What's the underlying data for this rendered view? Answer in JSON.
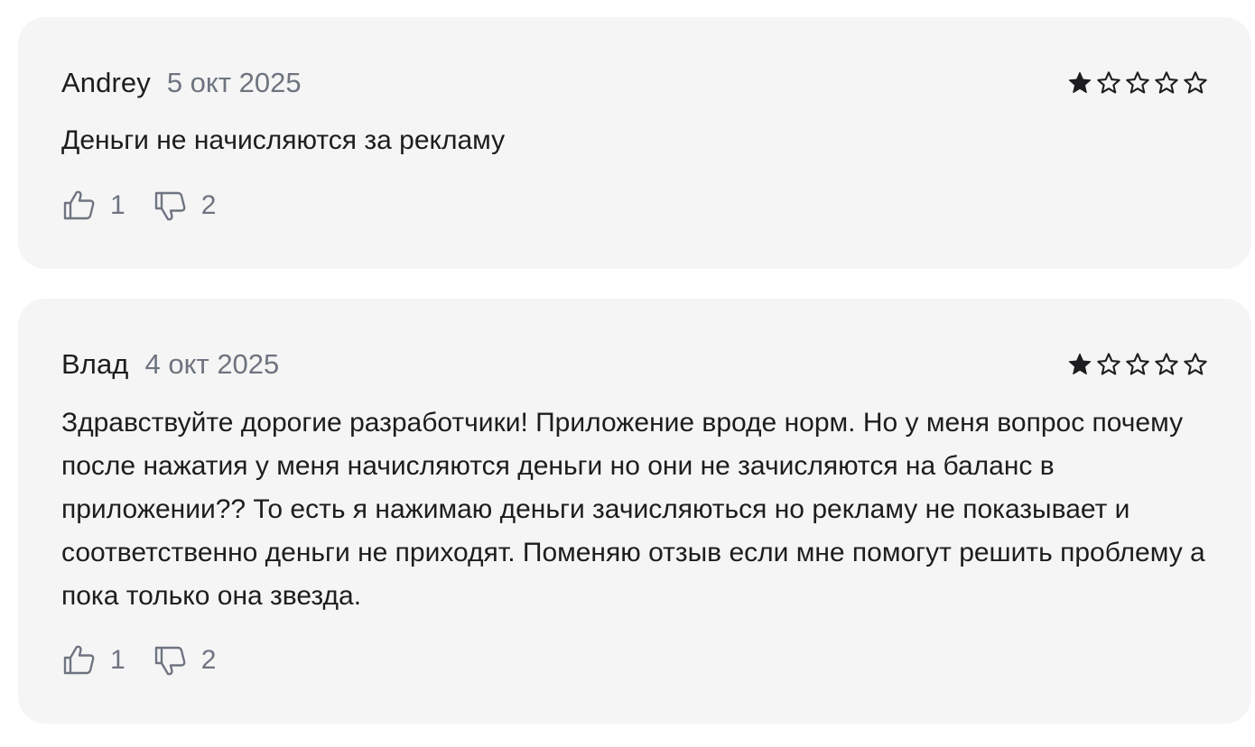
{
  "reviews": [
    {
      "author": "Andrey",
      "date": "5 окт 2025",
      "rating": 1,
      "rating_max": 5,
      "text": "Деньги не начисляются за рекламу",
      "likes": "1",
      "dislikes": "2"
    },
    {
      "author": "Влад",
      "date": "4 окт 2025",
      "rating": 1,
      "rating_max": 5,
      "text": "Здравствуйте дорогие разработчики! Приложение вроде норм. Но у меня вопрос почему после нажатия у меня начисляются деньги но они не зачисляются на баланс в приложении?? То есть я нажимаю деньги зачисляються но рекламу не показывает и соответственно деньги не приходят. Поменяю отзыв если мне помогут решить проблему а пока только она звезда.",
      "likes": "1",
      "dislikes": "2"
    }
  ],
  "icons": {
    "star_filled": "star-filled-icon",
    "star_empty": "star-outline-icon",
    "like": "thumbs-up-icon",
    "dislike": "thumbs-down-icon"
  },
  "colors": {
    "card_background": "#f5f5f5",
    "muted_text": "#6e7480",
    "primary_text": "#1d1d1f"
  }
}
